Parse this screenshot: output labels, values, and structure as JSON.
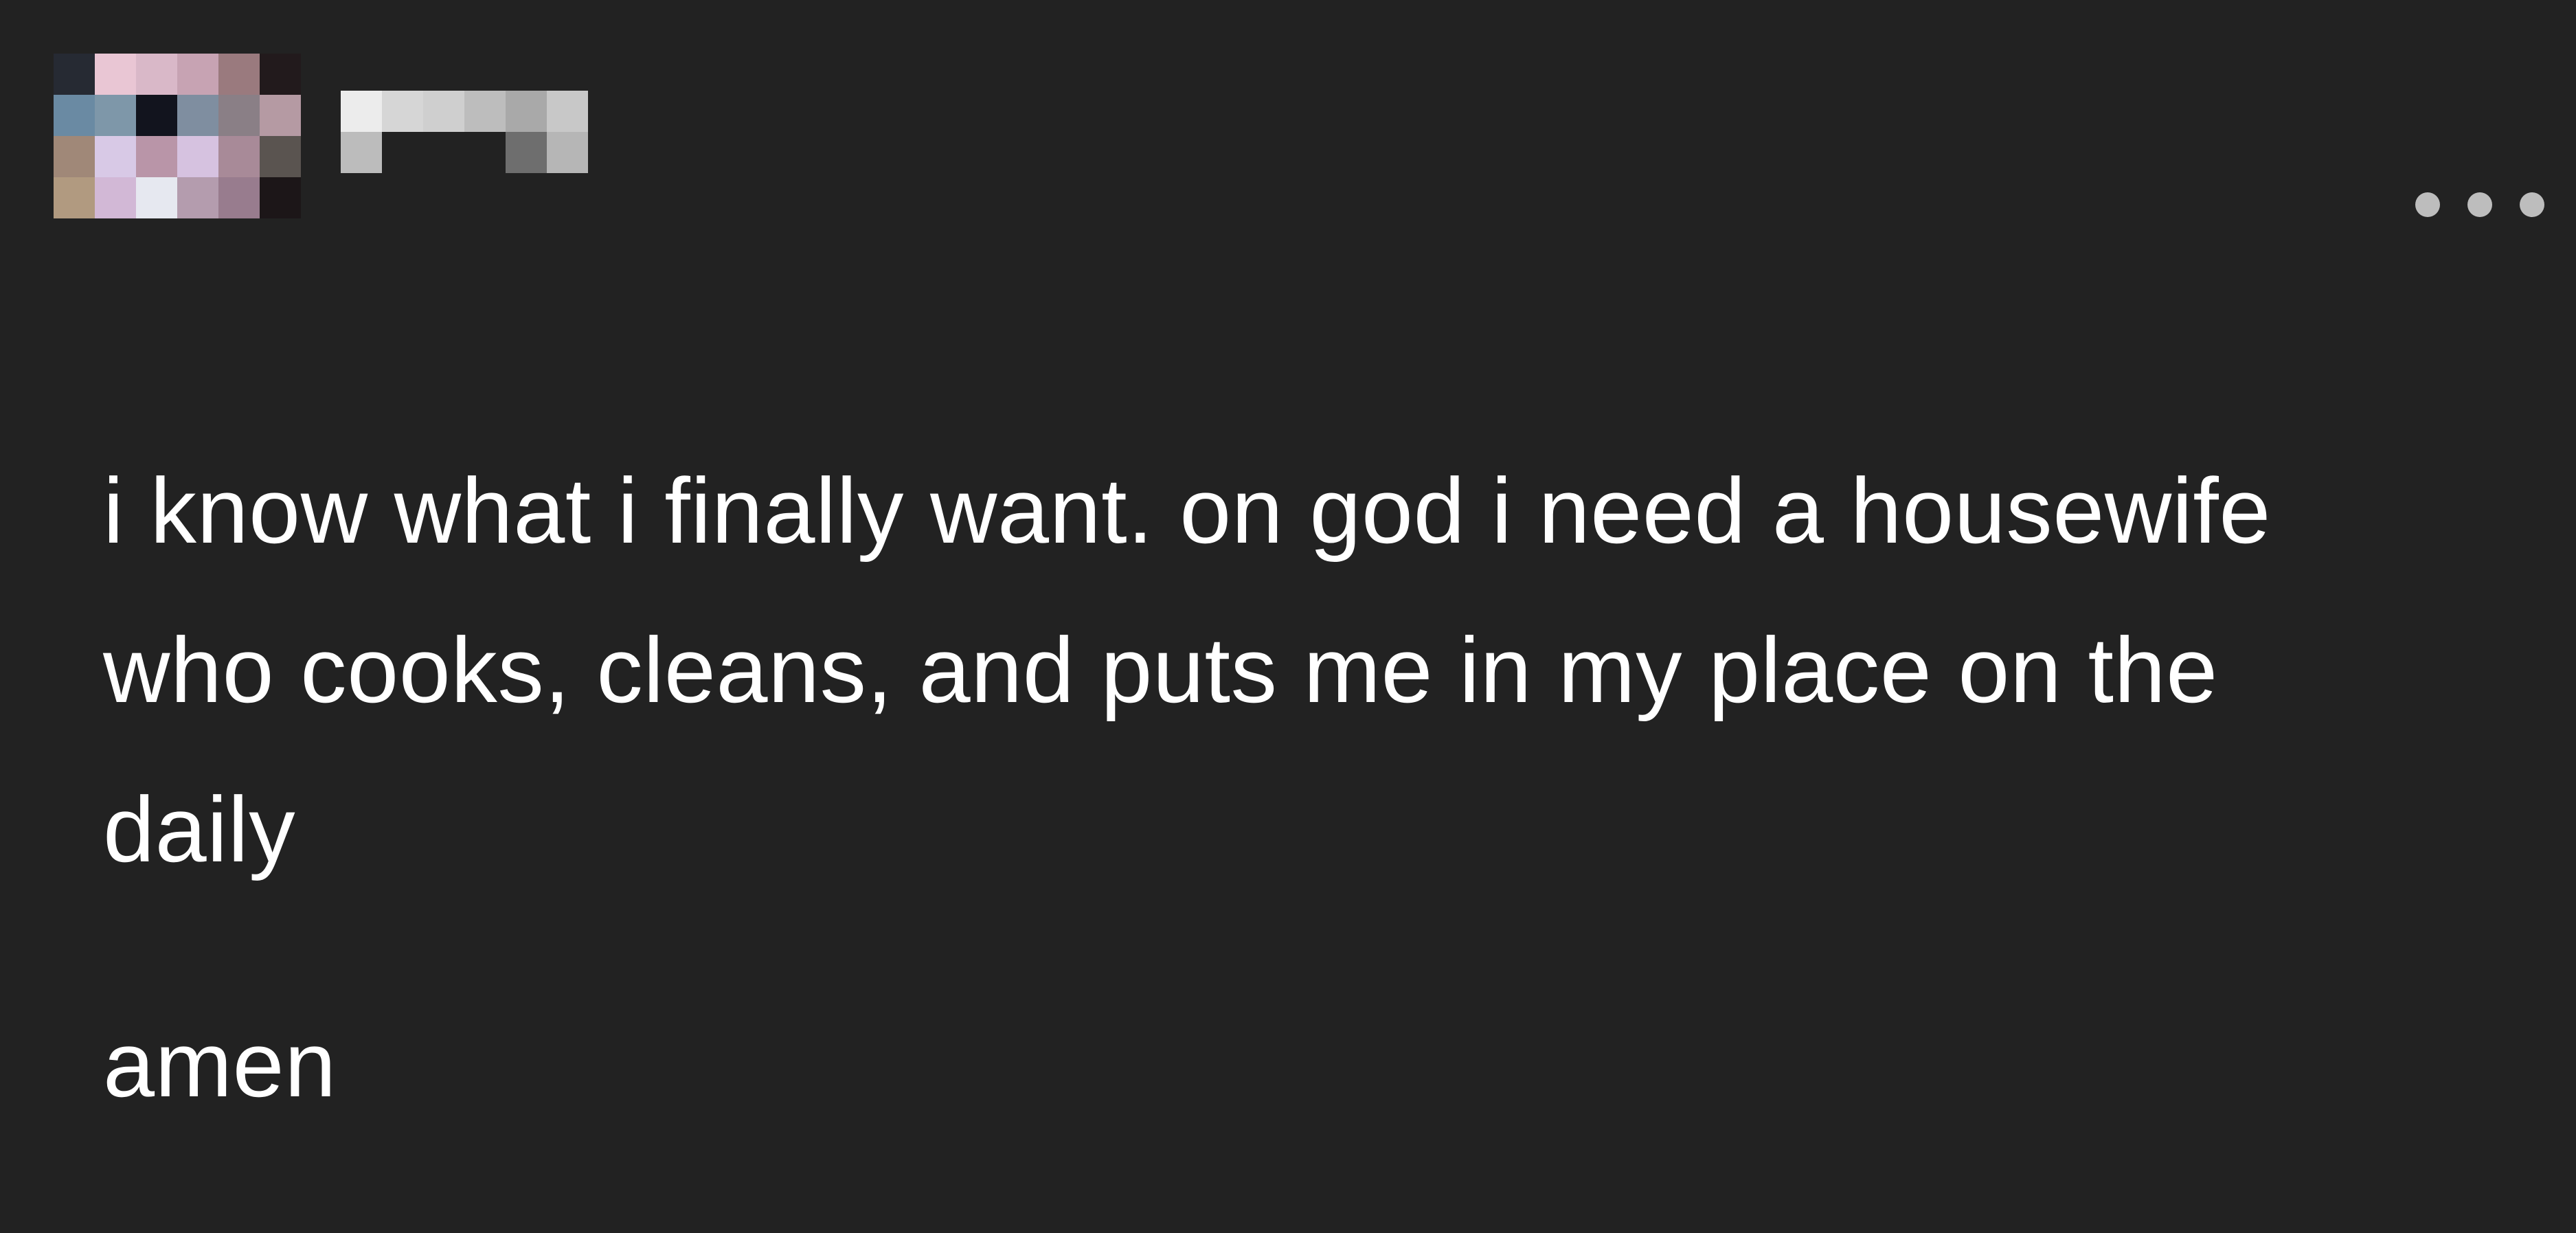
{
  "post": {
    "header": {
      "avatar_icon": "pixelated-avatar",
      "username": "",
      "more_icon": "ellipsis-icon"
    },
    "paragraphs": [
      "i know what i finally want. on god i need a housewife who cooks, cleans, and puts me in my place on the daily",
      "amen"
    ]
  },
  "colors": {
    "background": "#222222",
    "text": "#ffffff",
    "more_dots": "#bdbdbd"
  }
}
